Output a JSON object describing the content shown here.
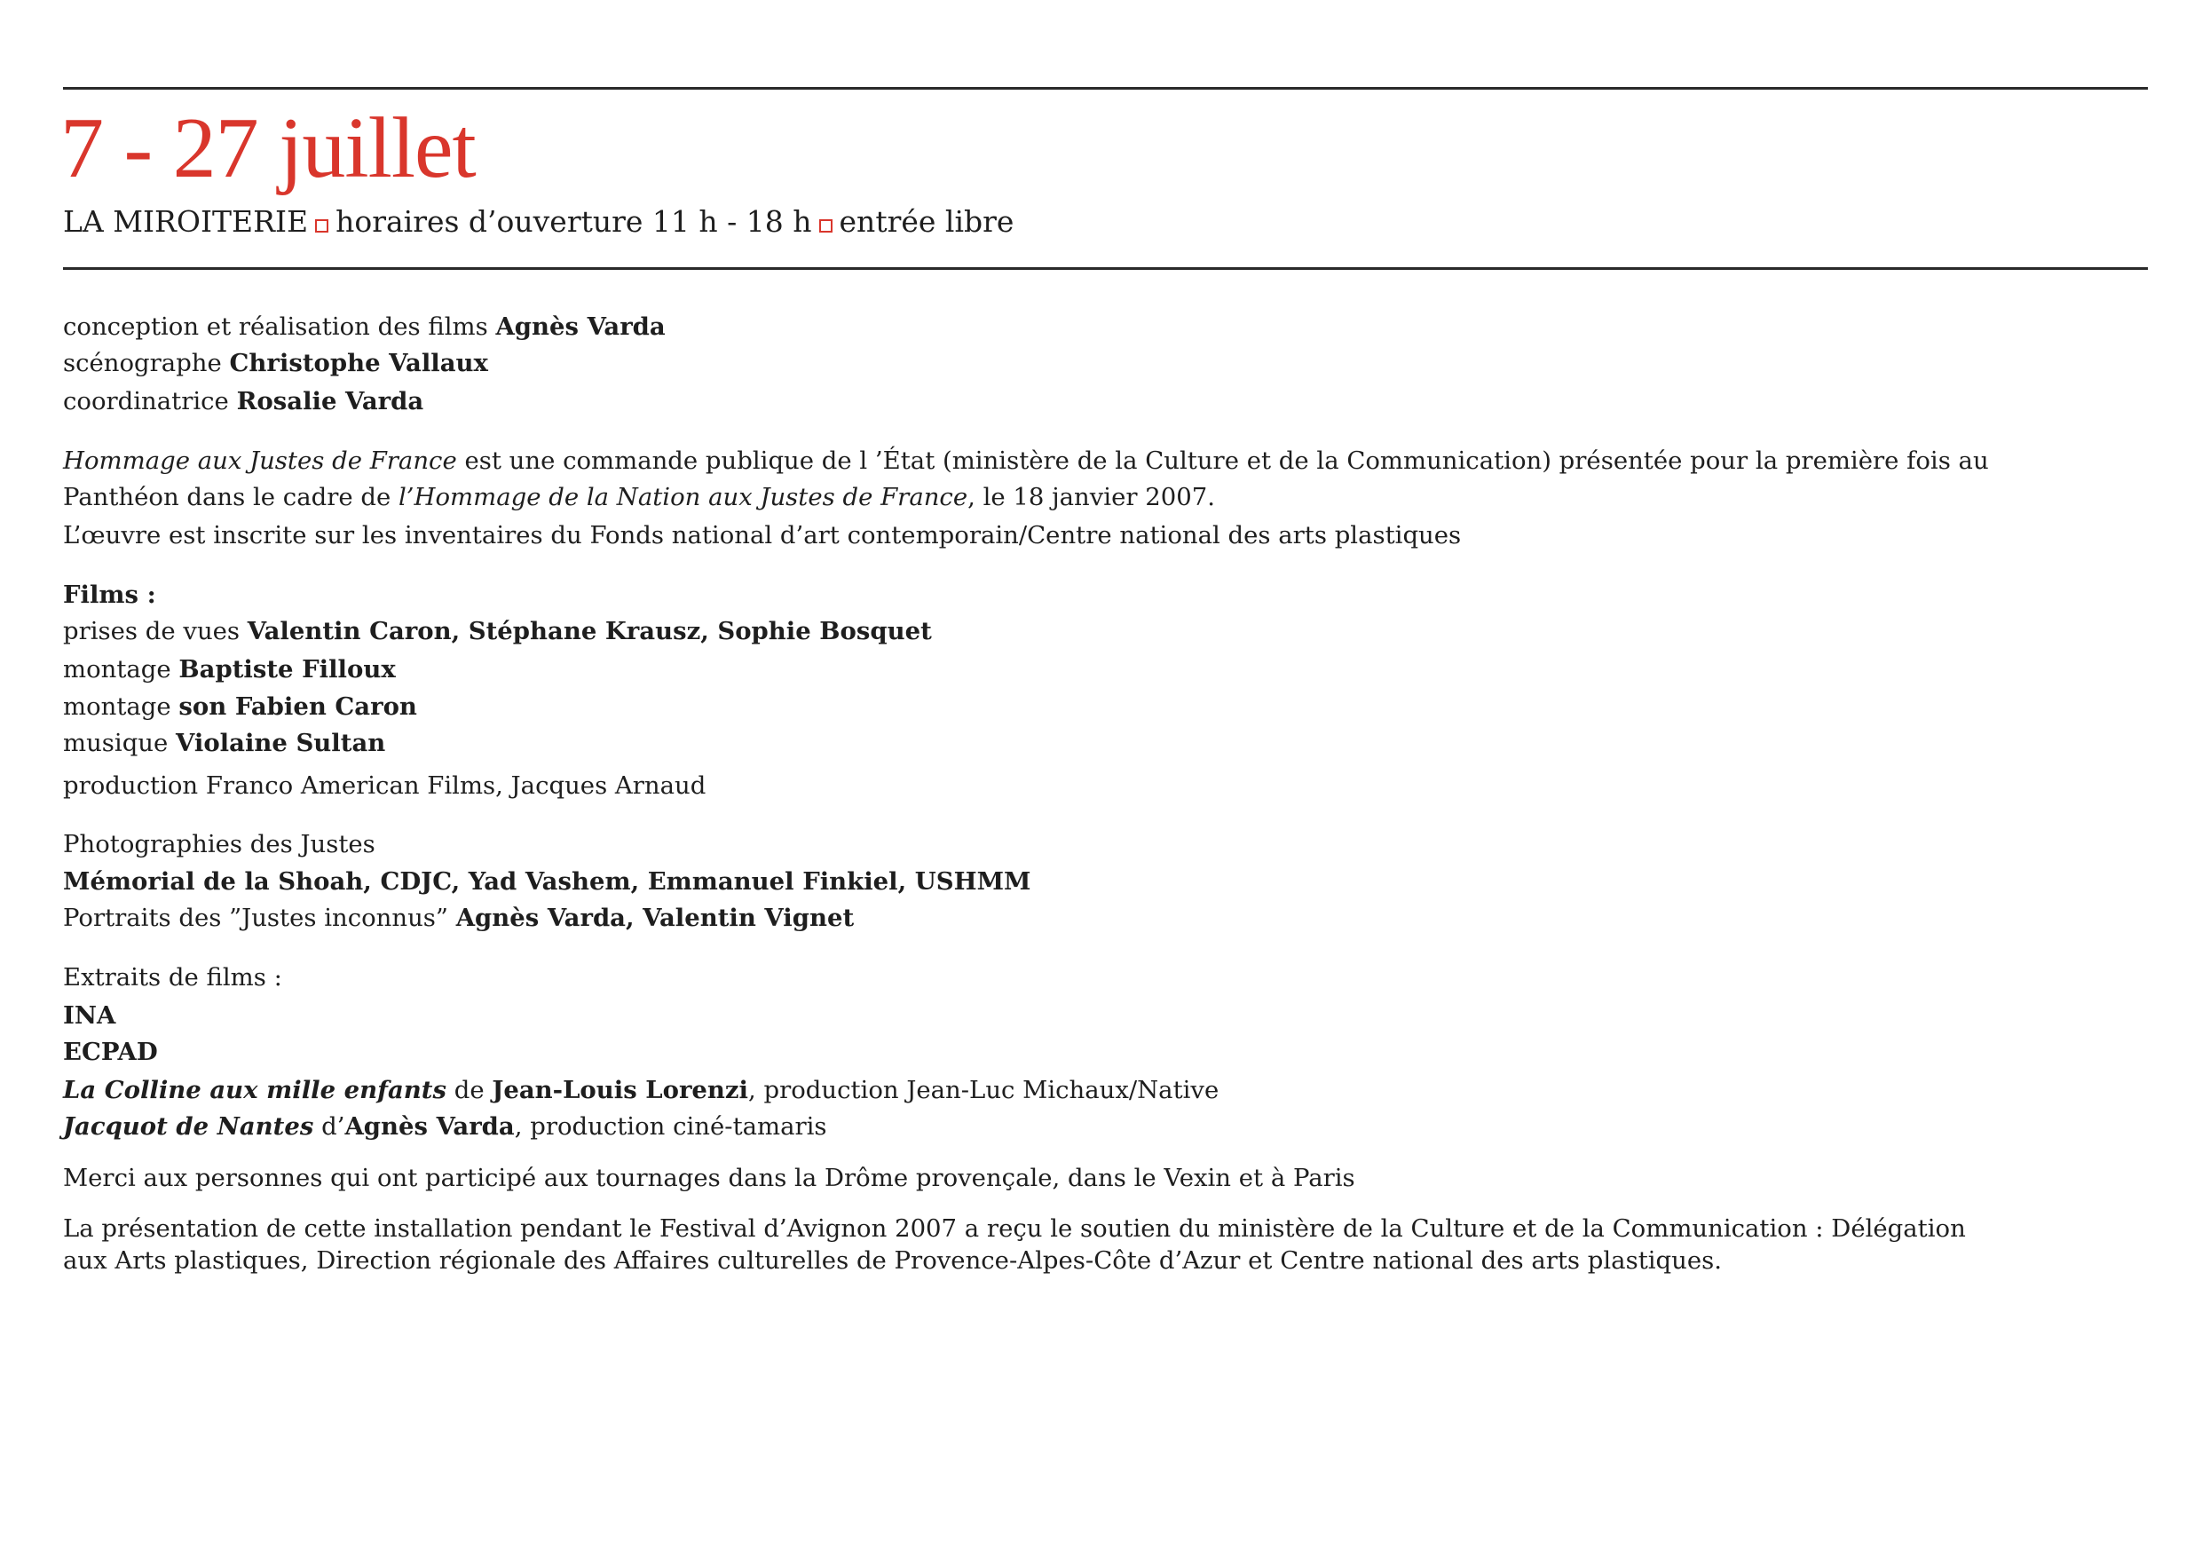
{
  "header": {
    "title": "7 - 27 juillet",
    "venue": "LA MIROITERIE",
    "hours": "horaires d’ouverture 11 h - 18 h",
    "admission": "entrée libre",
    "accent_color": "#d9362c"
  },
  "lines": [
    [
      [
        "conception et réalisation des films ",
        ""
      ],
      [
        "Agnès Varda",
        "b"
      ]
    ],
    [
      [
        "scénographe ",
        ""
      ],
      [
        "Christophe Vallaux",
        "b"
      ]
    ],
    [
      [
        "coordinatrice ",
        ""
      ],
      [
        "Rosalie Varda",
        "b"
      ]
    ],
    [
      [
        "Hommage aux Justes de France",
        "i"
      ],
      [
        " est une commande publique de l ’État (ministère de la Culture et de la Communication) présentée pour la première fois au",
        ""
      ]
    ],
    [
      [
        "Panthéon dans le cadre de ",
        ""
      ],
      [
        "l’Hommage de la Nation aux Justes de France",
        "i"
      ],
      [
        ", le 18 janvier 2007.",
        ""
      ]
    ],
    [
      [
        "L’œuvre est inscrite sur les inventaires du Fonds national d’art contemporain/Centre national des arts plastiques",
        ""
      ]
    ],
    [
      [
        "Films :",
        "b"
      ]
    ],
    [
      [
        "prises de vues ",
        ""
      ],
      [
        "Valentin Caron, Stéphane Krausz, Sophie Bosquet",
        "b"
      ]
    ],
    [
      [
        "montage ",
        ""
      ],
      [
        "Baptiste Filloux",
        "b"
      ]
    ],
    [
      [
        "montage ",
        ""
      ],
      [
        "son Fabien Caron",
        "b"
      ]
    ],
    [
      [
        "musique ",
        ""
      ],
      [
        "Violaine Sultan",
        "b"
      ]
    ],
    [
      [
        "production Franco American Films, Jacques Arnaud",
        ""
      ]
    ],
    [
      [
        "Photographies des Justes",
        ""
      ]
    ],
    [
      [
        "Mémorial de la Shoah, CDJC, Yad Vashem, Emmanuel Finkiel, USHMM",
        "b"
      ]
    ],
    [
      [
        "Portraits des ”Justes inconnus” ",
        ""
      ],
      [
        "Agnès Varda, Valentin Vignet",
        "b"
      ]
    ],
    [
      [
        "Extraits de films :",
        ""
      ]
    ],
    [
      [
        "INA",
        "b"
      ]
    ],
    [
      [
        "ECPAD",
        "b"
      ]
    ],
    [
      [
        "La Colline aux mille enfants",
        "b i"
      ],
      [
        " de ",
        ""
      ],
      [
        "Jean-Louis Lorenzi",
        "b"
      ],
      [
        ", production Jean-Luc Michaux/Native",
        ""
      ]
    ],
    [
      [
        "Jacquot de Nantes",
        "b i"
      ],
      [
        " d’",
        ""
      ],
      [
        "Agnès Varda",
        "b"
      ],
      [
        ", production ciné-tamaris",
        ""
      ]
    ],
    [
      [
        "Merci aux personnes qui ont participé aux tournages dans la Drôme provençale, dans le Vexin et à Paris",
        ""
      ]
    ],
    [
      [
        "La présentation de cette installation pendant le Festival d’Avignon 2007 a reçu le soutien du ministère de la Culture et de la Communication : Délégation",
        ""
      ]
    ],
    [
      [
        "aux Arts plastiques, Direction régionale des Affaires culturelles de Provence-Alpes-Côte d’Azur et Centre national des arts plastiques.",
        ""
      ]
    ]
  ]
}
